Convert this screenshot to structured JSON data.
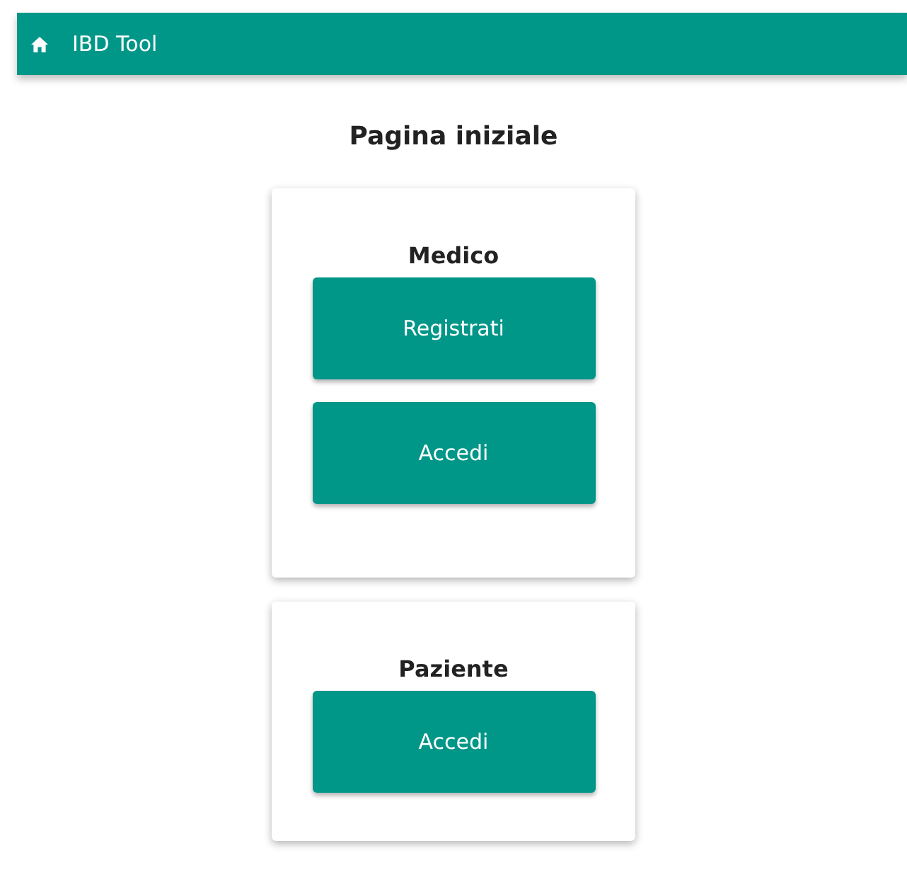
{
  "app_bar": {
    "title": "IBD Tool"
  },
  "page_title": "Pagina iniziale",
  "cards": [
    {
      "title": "Medico",
      "buttons": [
        "Registrati",
        "Accedi"
      ]
    },
    {
      "title": "Paziente",
      "buttons": [
        "Accedi"
      ]
    }
  ]
}
